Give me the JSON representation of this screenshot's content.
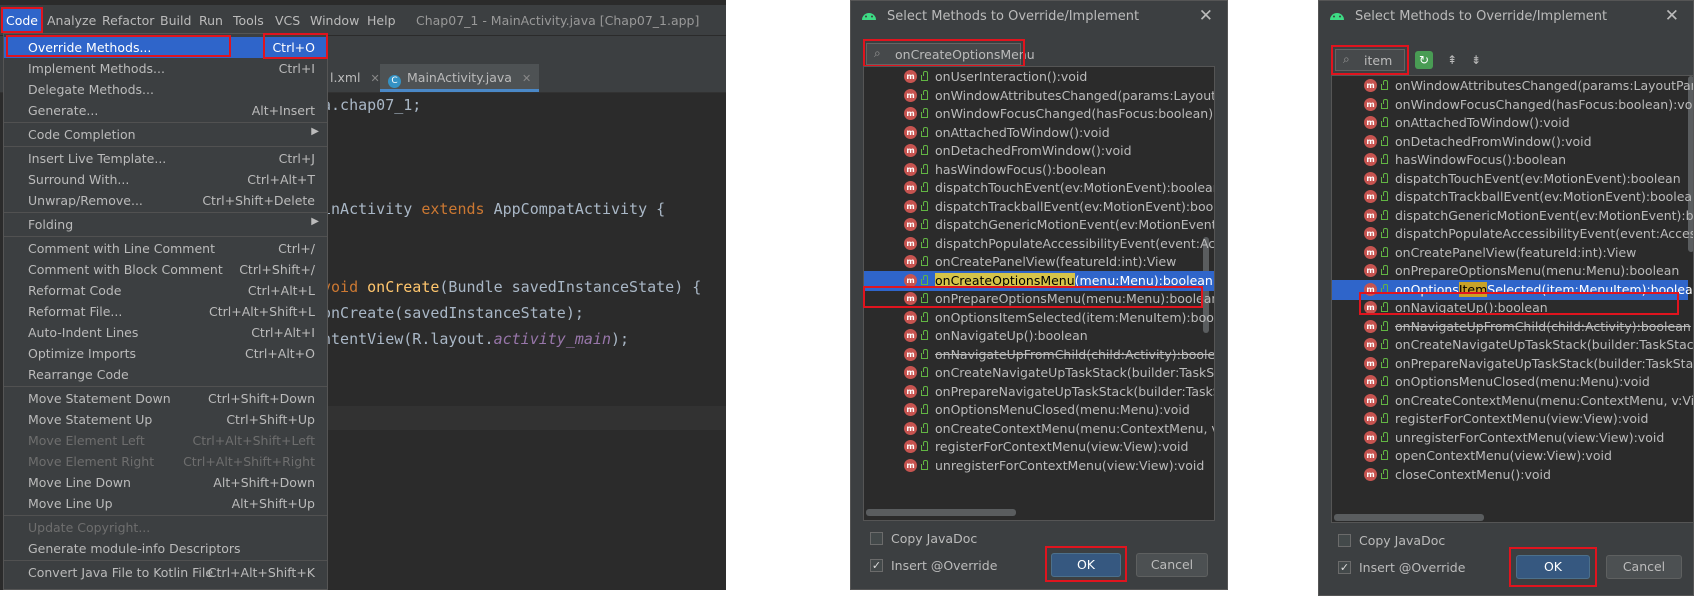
{
  "ide": {
    "menubar": [
      "Code",
      "Analyze",
      "Refactor",
      "Build",
      "Run",
      "Tools",
      "VCS",
      "Window",
      "Help"
    ],
    "title": "Chap07_1 - MainActivity.java [Chap07_1.app]",
    "tabs": [
      {
        "label": "l.xml"
      },
      {
        "label": "MainActivity.java"
      }
    ],
    "code_lines": {
      "l1": "a.chap07_1;",
      "l2_pre": "inActivity ",
      "l2_kw": "extends",
      "l2_post": " AppCompatActivity {",
      "l3_kw": "void",
      "l3_fn": "onCreate",
      "l3_post": "(Bundle savedInstanceState) {",
      "l4": "onCreate(savedInstanceState);",
      "l5_pre": "ntentView(R.layout.",
      "l5_it": "activity_main",
      "l5_post": ");"
    },
    "menu": {
      "items": [
        {
          "label": "Override Methods...",
          "shortcut": "Ctrl+O"
        },
        {
          "label": "Implement Methods...",
          "shortcut": "Ctrl+I"
        },
        {
          "label": "Delegate Methods...",
          "shortcut": ""
        },
        {
          "label": "Generate...",
          "shortcut": "Alt+Insert"
        },
        {
          "label": "Code Completion",
          "shortcut": ""
        },
        {
          "label": "Insert Live Template...",
          "shortcut": "Ctrl+J"
        },
        {
          "label": "Surround With...",
          "shortcut": "Ctrl+Alt+T"
        },
        {
          "label": "Unwrap/Remove...",
          "shortcut": "Ctrl+Shift+Delete"
        },
        {
          "label": "Folding",
          "shortcut": ""
        },
        {
          "label": "Comment with Line Comment",
          "shortcut": "Ctrl+/"
        },
        {
          "label": "Comment with Block Comment",
          "shortcut": "Ctrl+Shift+/"
        },
        {
          "label": "Reformat Code",
          "shortcut": "Ctrl+Alt+L"
        },
        {
          "label": "Reformat File...",
          "shortcut": "Ctrl+Alt+Shift+L"
        },
        {
          "label": "Auto-Indent Lines",
          "shortcut": "Ctrl+Alt+I"
        },
        {
          "label": "Optimize Imports",
          "shortcut": "Ctrl+Alt+O"
        },
        {
          "label": "Rearrange Code",
          "shortcut": ""
        },
        {
          "label": "Move Statement Down",
          "shortcut": "Ctrl+Shift+Down"
        },
        {
          "label": "Move Statement Up",
          "shortcut": "Ctrl+Shift+Up"
        },
        {
          "label": "Move Element Left",
          "shortcut": "Ctrl+Alt+Shift+Left"
        },
        {
          "label": "Move Element Right",
          "shortcut": "Ctrl+Alt+Shift+Right"
        },
        {
          "label": "Move Line Down",
          "shortcut": "Alt+Shift+Down"
        },
        {
          "label": "Move Line Up",
          "shortcut": "Alt+Shift+Up"
        },
        {
          "label": "Update Copyright...",
          "shortcut": ""
        },
        {
          "label": "Generate module-info Descriptors",
          "shortcut": ""
        },
        {
          "label": "Convert Java File to Kotlin File",
          "shortcut": "Ctrl+Alt+Shift+K"
        }
      ]
    }
  },
  "dialog1": {
    "title": "Select Methods to Override/Implement",
    "search_value": "onCreateOptionsMenu",
    "methods": [
      "onUserInteraction():void",
      "onWindowAttributesChanged(params:LayoutParam",
      "onWindowFocusChanged(hasFocus:boolean):void",
      "onAttachedToWindow():void",
      "onDetachedFromWindow():void",
      "hasWindowFocus():boolean",
      "dispatchTouchEvent(ev:MotionEvent):boolean",
      "dispatchTrackballEvent(ev:MotionEvent):boolean",
      "dispatchGenericMotionEvent(ev:MotionEvent):bool",
      "dispatchPopulateAccessibilityEvent(event:Accessib",
      "onCreatePanelView(featureId:int):View",
      "onCreateOptionsMenu(menu:Menu):boolean",
      "onPrepareOptionsMenu(menu:Menu):boolean",
      "onOptionsItemSelected(item:MenuItem):boolean",
      "onNavigateUp():boolean",
      "onNavigateUpFromChild(child:Activity):boolean",
      "onCreateNavigateUpTaskStack(builder:TaskStackBu",
      "onPrepareNavigateUpTaskStack(builder:TaskStackB",
      "onOptionsMenuClosed(menu:Menu):void",
      "onCreateContextMenu(menu:ContextMenu, v:View",
      "registerForContextMenu(view:View):void",
      "unregisterForContextMenu(view:View):void"
    ],
    "selected_name": "onCreateOptionsMenu",
    "selected_rest": "(menu:Menu):boolean",
    "copy_javadoc": "Copy JavaDoc",
    "insert_override": "Insert @Override",
    "ok": "OK",
    "cancel": "Cancel"
  },
  "dialog2": {
    "title": "Select Methods to Override/Implement",
    "search_value": "item",
    "methods": [
      "onWindowAttributesChanged(params:LayoutParam",
      "onWindowFocusChanged(hasFocus:boolean):void",
      "onAttachedToWindow():void",
      "onDetachedFromWindow():void",
      "hasWindowFocus():boolean",
      "dispatchTouchEvent(ev:MotionEvent):boolean",
      "dispatchTrackballEvent(ev:MotionEvent):boolean",
      "dispatchGenericMotionEvent(ev:MotionEvent):bool",
      "dispatchPopulateAccessibilityEvent(event:Accessibi",
      "onCreatePanelView(featureId:int):View",
      "onPrepareOptionsMenu(menu:Menu):boolean",
      "onOptionsItemSelected(item:MenuItem):boolean",
      "onNavigateUp():boolean",
      "onNavigateUpFromChild(child:Activity):boolean",
      "onCreateNavigateUpTaskStack(builder:TaskStackBu",
      "onPrepareNavigateUpTaskStack(builder:TaskStackB",
      "onOptionsMenuClosed(menu:Menu):void",
      "onCreateContextMenu(menu:ContextMenu, v:View",
      "registerForContextMenu(view:View):void",
      "unregisterForContextMenu(view:View):void",
      "openContextMenu(view:View):void",
      "closeContextMenu():void"
    ],
    "selected_pre": "onOptions",
    "selected_match": "Item",
    "selected_post": "Selected(item:MenuItem):boolean",
    "copy_javadoc": "Copy JavaDoc",
    "insert_override": "Insert @Override",
    "ok": "OK",
    "cancel": "Cancel"
  },
  "colors": {
    "highlight_box": "#e0141e",
    "selection": "#2f65ca",
    "ide_bg": "#2b2b2b",
    "panel_bg": "#3c3f41"
  },
  "icons": [
    "method-icon",
    "public-lock-icon",
    "search-icon",
    "android-icon",
    "close-icon",
    "expand-all-icon",
    "collapse-all-icon",
    "show-inherited-icon"
  ]
}
